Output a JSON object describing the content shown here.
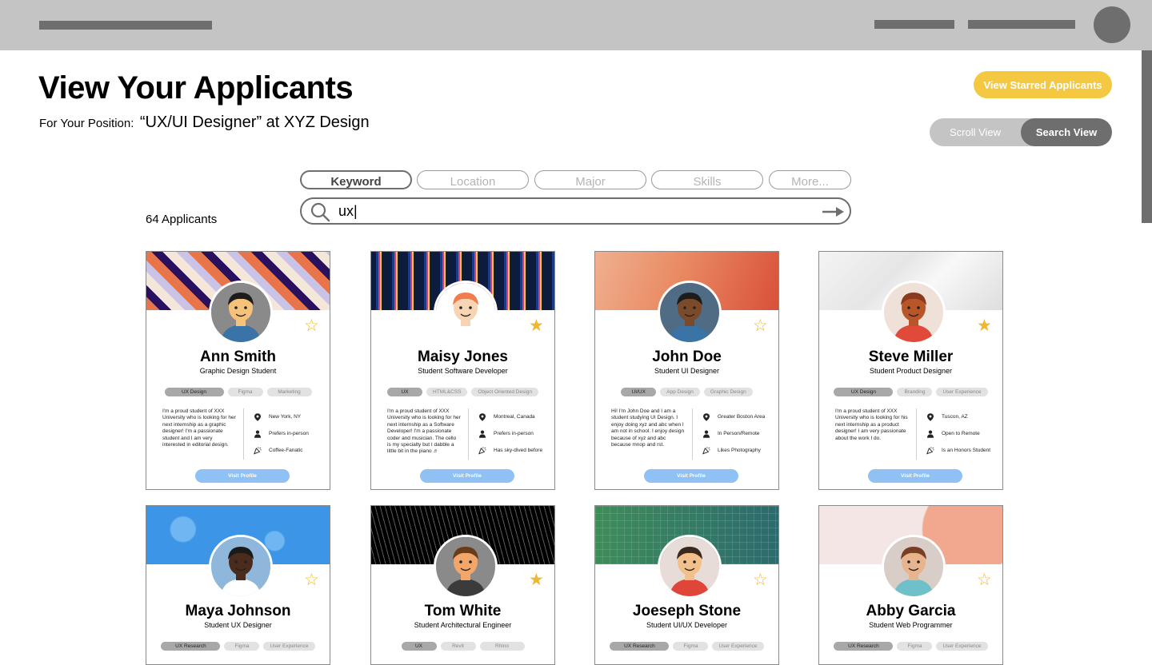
{
  "header": {
    "page_title": "View Your Applicants",
    "position_prefix": "For Your Position:",
    "position_value": "“UX/UI Designer” at XYZ Design"
  },
  "actions": {
    "starred_label": "View Starred Applicants",
    "toggle": {
      "scroll": "Scroll View",
      "search": "Search View",
      "active": "search"
    }
  },
  "filters": {
    "tabs": [
      "Keyword",
      "Location",
      "Major",
      "Skills",
      "More..."
    ],
    "active": "Keyword"
  },
  "search": {
    "value": "ux|"
  },
  "applicant_count": "64 Applicants",
  "colors": {
    "star": "#f0b72f",
    "starred_button": "#f5c842",
    "visit_button": "#8fc1f4",
    "toggle_active": "#6e6e6e",
    "topbar": "#c4c4c4"
  },
  "visit_label": "Visit Profile",
  "cards": [
    {
      "name": "Ann Smith",
      "role": "Graphic Design Student",
      "starred": false,
      "tags": [
        "UX Design",
        "Figma",
        "Marketing"
      ],
      "bio": "I'm a proud student of XXX University who is looking for her next internship as a graphic designer! I'm a passionate student and I am very interested in editorial design.",
      "details": [
        "New York, NY",
        "Prefers in-person",
        "Coffee-Fanatic"
      ]
    },
    {
      "name": "Maisy Jones",
      "role": "Student Software Developer",
      "starred": true,
      "tags": [
        "UX",
        "HTML&CSS",
        "Object Oriented Design"
      ],
      "bio": "I'm a proud student of XXX University who is looking for her next internship as a Software Developer! I'm a passionate coder and musician. The cello is my specialty but I dabble a little bit in the piano ♬",
      "details": [
        "Montreal, Canada",
        "Prefers in-person",
        "Has sky-dived before"
      ]
    },
    {
      "name": "John Doe",
      "role": "Student UI Designer",
      "starred": false,
      "tags": [
        "UI/UX",
        "App Design",
        "Graphic Design"
      ],
      "bio": "Hi! I'm John Doe and I am a student studying UI Design. I enjoy doing xyz and abc when I am not in school. I enjoy design because of xyz and abc because mnop and rst.",
      "details": [
        "Greater Boston Area",
        "In Person/Remote",
        "Likes Photography"
      ]
    },
    {
      "name": "Steve Miller",
      "role": "Student Product Designer",
      "starred": true,
      "tags": [
        "UX Design",
        "Branding",
        "User Experience"
      ],
      "bio": "I'm a proud student of XXX University who is looking for his next internship as a product designer! I am very passionate about the work I do.",
      "details": [
        "Tuscon, AZ",
        "Open to Remote",
        "Is an Honors Student"
      ]
    },
    {
      "name": "Maya Johnson",
      "role": "Student UX Designer",
      "starred": false,
      "tags": [
        "UX Research",
        "Figma",
        "User Experience"
      ],
      "bio": "",
      "details": []
    },
    {
      "name": "Tom White",
      "role": "Student Architectural Engineer",
      "starred": true,
      "tags": [
        "UX",
        "Revit",
        "Rhino"
      ],
      "bio": "",
      "details": []
    },
    {
      "name": "Joeseph Stone",
      "role": "Student UI/UX Developer",
      "starred": false,
      "tags": [
        "UX Research",
        "Figma",
        "User Experience"
      ],
      "bio": "",
      "details": []
    },
    {
      "name": "Abby Garcia",
      "role": "Student Web Programmer",
      "starred": false,
      "tags": [
        "UX Research",
        "Figma",
        "User Experience"
      ],
      "bio": "",
      "details": []
    }
  ]
}
